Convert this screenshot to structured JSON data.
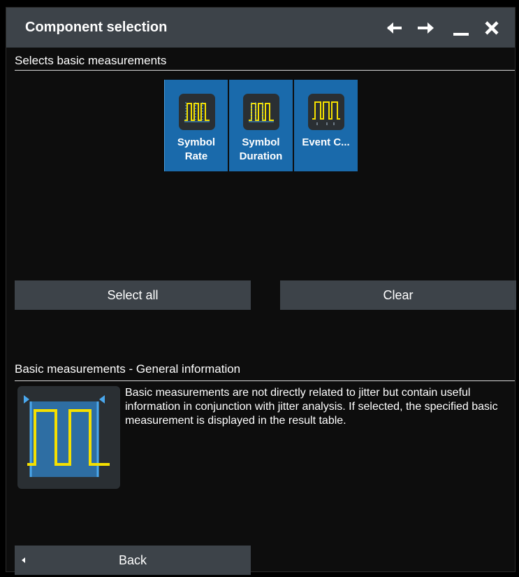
{
  "window": {
    "title": "Component selection",
    "back_icon": "arrow-left-icon",
    "forward_icon": "arrow-right-icon",
    "minimize_icon": "minimize-icon",
    "close_icon": "close-icon"
  },
  "selection": {
    "heading": "Selects basic measurements",
    "tiles": [
      {
        "label": "Symbol\nRate",
        "icon": "symbol-rate-icon"
      },
      {
        "label": "Symbol\nDuration",
        "icon": "symbol-duration-icon"
      },
      {
        "label": "Event C...",
        "icon": "event-count-icon"
      }
    ]
  },
  "actions": {
    "select_all": "Select all",
    "clear": "Clear"
  },
  "info": {
    "heading": "Basic measurements - General information",
    "text": "Basic measurements are not directly related to jitter but contain useful information in conjunction with jitter analysis. If selected, the specified basic measurement is displayed in the result table.",
    "image_icon": "basic-measurement-waveform-icon"
  },
  "footer": {
    "back": "Back",
    "back_icon": "caret-left-icon"
  },
  "colors": {
    "titlebar": "#3d4349",
    "tile_selected": "#1a6aab",
    "waveform_yellow": "#f5e000",
    "marker_blue": "#4aa8ee"
  }
}
